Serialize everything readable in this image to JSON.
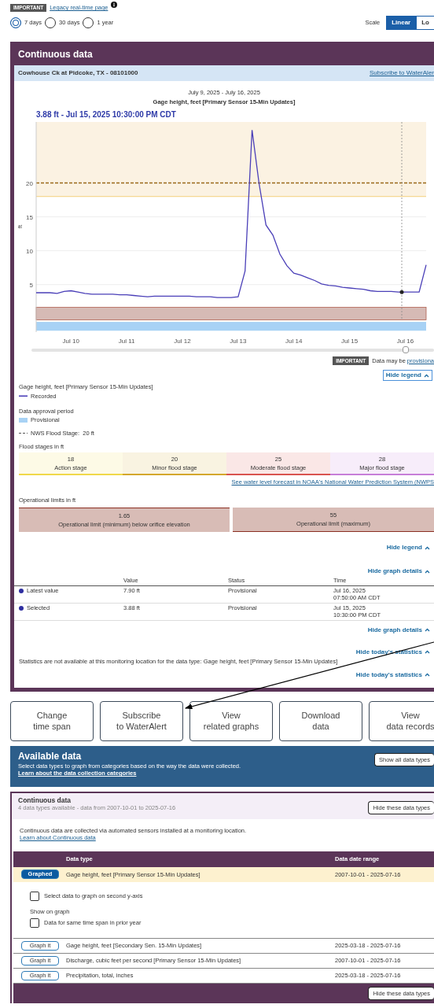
{
  "notice": {
    "badge": "IMPORTANT",
    "link": "Legacy real-time page"
  },
  "time_spans": [
    {
      "label": "7 days",
      "selected": true
    },
    {
      "label": "30 days",
      "selected": false
    },
    {
      "label": "1 year",
      "selected": false
    }
  ],
  "scale": {
    "label": "Scale",
    "options": [
      {
        "label": "Linear",
        "selected": true
      },
      {
        "label": "Lo",
        "selected": false
      }
    ]
  },
  "panel": {
    "title": "Continuous data",
    "site": "Cowhouse Ck at Pidcoke, TX - 08101000",
    "site_link": "Subscribe to WaterAler",
    "date_range": "July 9, 2025 - July 16, 2025",
    "graph_title": "Gage height, feet [Primary Sensor 15-Min Updates]",
    "reading": "3.88 ft - Jul 15, 2025 10:30:00 PM CDT",
    "chart_data": {
      "type": "line",
      "ylabel": "ft",
      "categories": [
        null,
        null,
        null,
        null,
        null,
        "Jul 10",
        null,
        null,
        null,
        null,
        null,
        null,
        null,
        "Jul 11",
        null,
        null,
        null,
        null,
        null,
        null,
        null,
        "Jul 12",
        null,
        null,
        null,
        null,
        null,
        null,
        null,
        "Jul 13",
        null,
        null,
        null,
        null,
        null,
        null,
        null,
        "Jul 14",
        null,
        null,
        null,
        null,
        null,
        null,
        null,
        "Jul 15",
        null,
        null,
        null,
        null,
        null,
        null,
        null,
        "Jul 16",
        null,
        null,
        null
      ],
      "series": [
        {
          "name": "Recorded",
          "color": "#4a3fb8",
          "values": [
            3.8,
            3.8,
            3.8,
            3.7,
            4.0,
            4.1,
            3.9,
            3.7,
            3.6,
            3.6,
            3.6,
            3.6,
            3.5,
            3.5,
            3.4,
            3.3,
            3.2,
            3.3,
            3.3,
            3.3,
            3.3,
            3.3,
            3.3,
            3.2,
            3.2,
            3.2,
            3.1,
            3.1,
            3.1,
            3.2,
            7.0,
            27.8,
            20.0,
            13.8,
            12.3,
            9.5,
            7.8,
            6.7,
            6.4,
            6.0,
            5.6,
            5.1,
            4.9,
            4.8,
            4.6,
            4.5,
            4.4,
            4.3,
            4.1,
            4.0,
            4.0,
            4.0,
            3.9,
            3.9,
            3.9,
            3.9,
            7.9
          ]
        }
      ],
      "ylim": [
        -2,
        29
      ],
      "yticks": [
        5,
        10,
        15,
        20
      ],
      "grid": true,
      "bands": [
        {
          "axis": "y",
          "from": 18,
          "to": 29
        },
        {
          "axis": "y",
          "from": -0.2,
          "to": 1.65
        },
        {
          "axis": "y",
          "from": -1.8,
          "to": -0.5
        }
      ],
      "ref_lines": [
        {
          "axis": "y",
          "value": 18
        },
        {
          "axis": "y",
          "value": 20
        }
      ]
    },
    "brush": {
      "level": 0.93
    },
    "provisional_notice": {
      "badge": "IMPORTANT",
      "text": "Data may be",
      "link": "provisiona"
    },
    "legend": {
      "toggle": "Hide legend",
      "series_title": "Gage height, feet [Primary Sensor 15-Min Updates]",
      "approval_title": "Data approval period",
      "approval_label": "Provisional",
      "flood_line_label": "NWS Flood Stage:  20 ft",
      "stages_title": "Flood stages in ft",
      "stages": [
        {
          "value": "18",
          "label": "Action stage",
          "color": "#f0d84a"
        },
        {
          "value": "20",
          "label": "Minor flood stage",
          "color": "#d4a72c"
        },
        {
          "value": "25",
          "label": "Moderate flood stage",
          "color": "#d9534f"
        },
        {
          "value": "28",
          "label": "Major flood stage",
          "color": "#c77ed8"
        }
      ],
      "forecast_link": "See water level forecast in NOAA's National Water Prediction System (NWPS",
      "limits_title": "Operational limits in ft",
      "limits": [
        {
          "value": "1.65",
          "label": "Operational limit (minimum) below orifice elevation"
        },
        {
          "value": "55",
          "label": "Operational limit (maximum)"
        }
      ],
      "toggle_bottom": "Hide legend"
    },
    "details": {
      "toggle": "Hide graph details",
      "columns": [
        "Value",
        "Status",
        "Time"
      ],
      "rows": [
        {
          "label": "Latest value",
          "value": "7.90 ft",
          "status": "Provisional",
          "date": "Jul 16, 2025",
          "clock": "07:50:00 AM CDT"
        },
        {
          "label": "Selected",
          "value": "3.88 ft",
          "status": "Provisional",
          "date": "Jul 15, 2025",
          "clock": "10:30:00 PM CDT"
        }
      ],
      "toggle_bottom": "Hide graph details"
    },
    "statistics": {
      "toggle": "Hide today's statistics",
      "message": "Statistics are not available at this monitoring location for the data type: Gage height, feet [Primary Sensor 15-Min Updates]",
      "toggle_bottom": "Hide today's statistics"
    }
  },
  "actions": [
    {
      "lines": [
        "Change",
        "time span"
      ]
    },
    {
      "lines": [
        "Subscribe",
        "to WaterAlert"
      ]
    },
    {
      "lines": [
        "View",
        "related graphs"
      ]
    },
    {
      "lines": [
        "Download",
        "data"
      ]
    },
    {
      "lines": [
        "View",
        "data records"
      ]
    }
  ],
  "available": {
    "title": "Available data",
    "text": "Select data types to graph from categories based on the way the data were collected.",
    "link": "Learn about the data collection categories",
    "button": "Show all data types"
  },
  "category": {
    "title": "Continuous data",
    "subtitle": "4 data types available - data from 2007-10-01 to 2025-07-16",
    "button": "Hide these data types",
    "description": "Continuous data are collected via automated sensors installed at a monitoring location.",
    "link": "Learn about Continuous data",
    "columns": [
      "Data type",
      "Data date range"
    ],
    "rows": [
      {
        "button": "Graphed",
        "selected": true,
        "name": "Gage height, feet [Primary Sensor 15-Min Updates]",
        "range": "2007-10-01 - 2025-07-16"
      },
      {
        "button": "Graph it",
        "selected": false,
        "name": "Gage height, feet [Secondary Sen. 15-Min Updates]",
        "range": "2025-03-18 - 2025-07-16"
      },
      {
        "button": "Graph it",
        "selected": false,
        "name": "Discharge, cubic feet per second [Primary Sensor 15-Min Updates]",
        "range": "2007-10-01 - 2025-07-16"
      },
      {
        "button": "Graph it",
        "selected": false,
        "name": "Precipitation, total, inches",
        "range": "2025-03-18 - 2025-07-16"
      }
    ],
    "options": [
      {
        "kind": "checkbox",
        "label": "Select data to graph on second y-axis",
        "checked": false
      },
      {
        "kind": "heading",
        "label": "Show on graph"
      },
      {
        "kind": "checkbox",
        "label": "Data for same time span in prior year",
        "checked": false
      }
    ],
    "footer_button": "Hide these data types"
  }
}
